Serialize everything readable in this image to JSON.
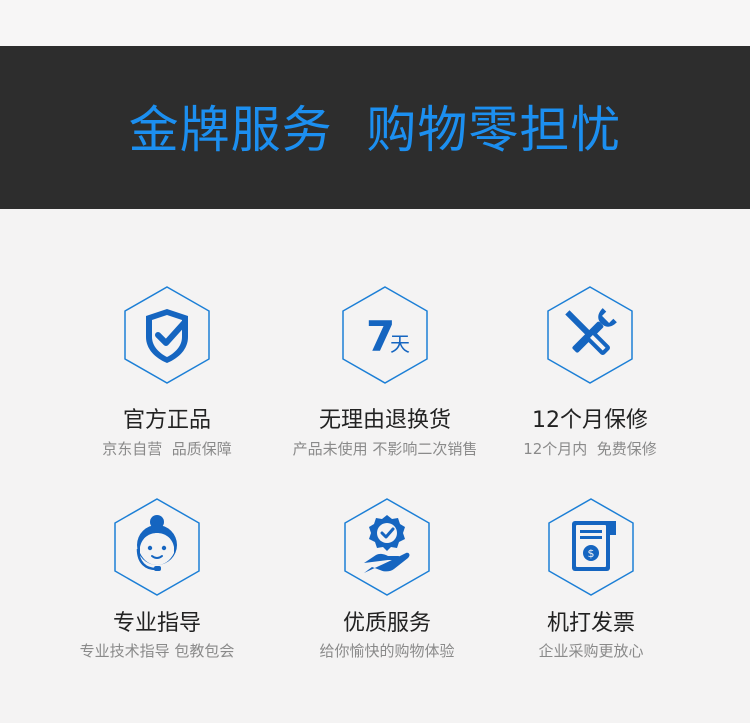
{
  "banner": {
    "title": "金牌服务  购物零担忧"
  },
  "colors": {
    "accent": "#1c8ff0",
    "icon_blue": "#1565c0",
    "banner_bg": "#2d2d2d"
  },
  "features": [
    {
      "title": "官方正品",
      "subtitle": "京东自营  品质保障",
      "icon": "shield-check-icon"
    },
    {
      "title": "无理由退换货",
      "subtitle": "产品未使用 不影响二次销售",
      "icon": "seven-days-icon",
      "icon_text_big": "7",
      "icon_text_small": "天"
    },
    {
      "title": "12个月保修",
      "subtitle": "12个月内  免费保修",
      "icon": "wrench-screwdriver-icon"
    },
    {
      "title": "专业指导",
      "subtitle": "专业技术指导 包教包会",
      "icon": "customer-service-icon"
    },
    {
      "title": "优质服务",
      "subtitle": "给你愉快的购物体验",
      "icon": "hand-badge-icon"
    },
    {
      "title": "机打发票",
      "subtitle": "企业采购更放心",
      "icon": "invoice-icon"
    }
  ]
}
